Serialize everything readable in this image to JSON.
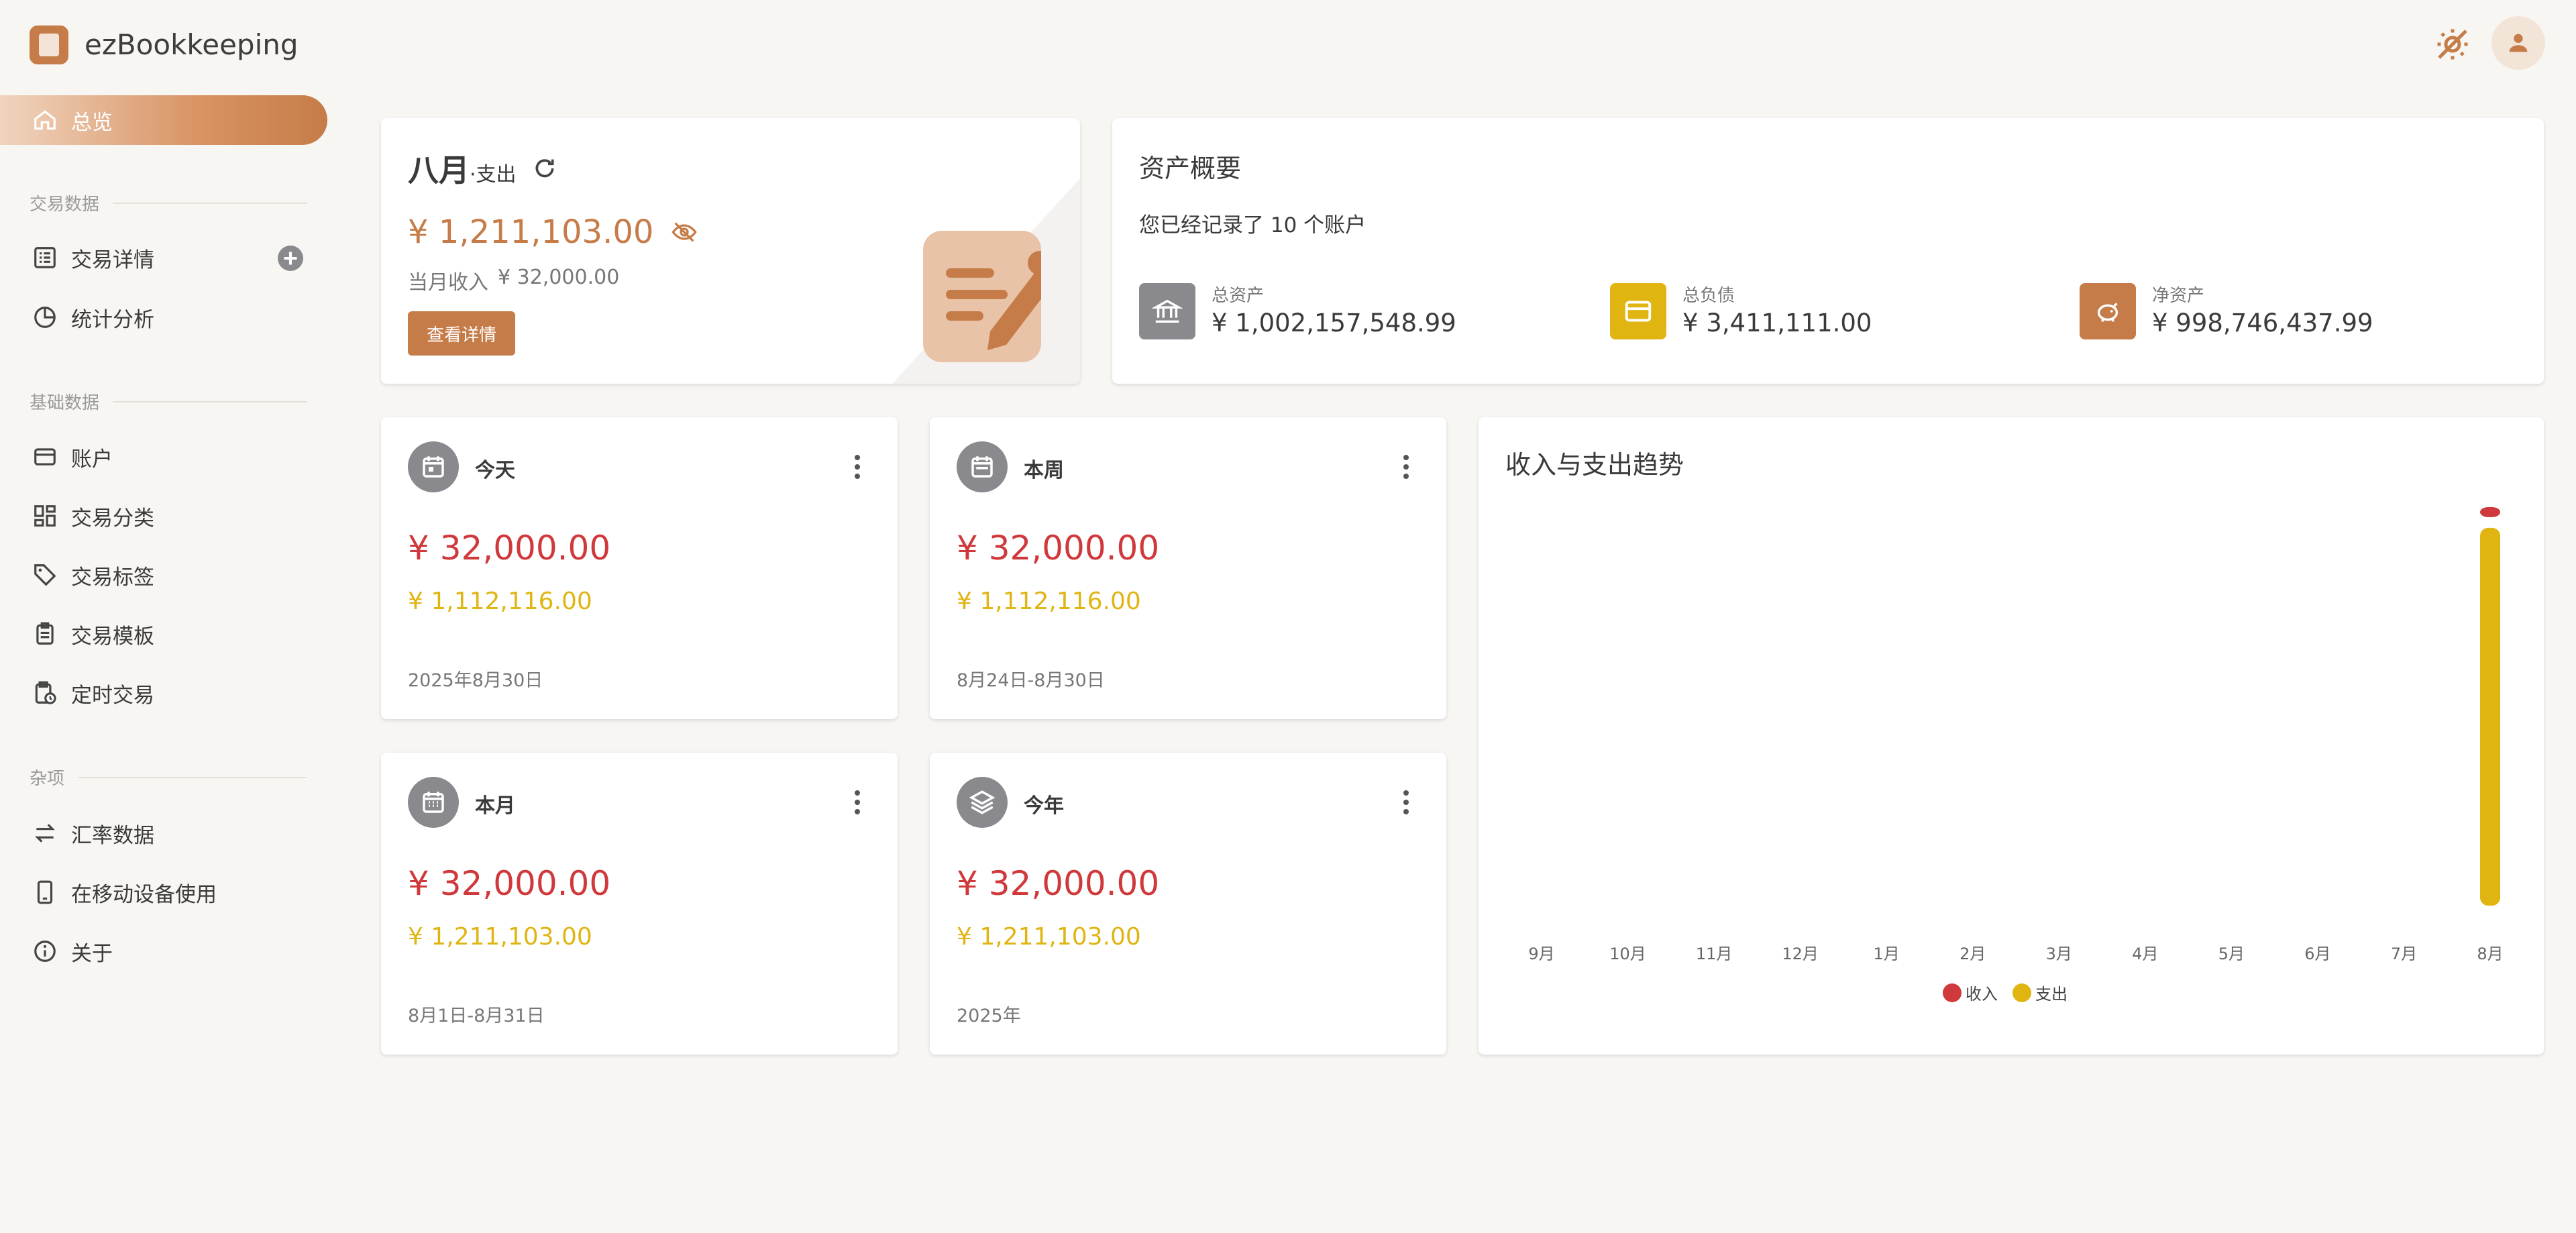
{
  "app": {
    "title": "ezBookkeeping"
  },
  "sidebar": {
    "overview": "总览",
    "sections": {
      "transaction_data": "交易数据",
      "basic_data": "基础数据",
      "misc": "杂项"
    },
    "items": {
      "transaction_details": "交易详情",
      "statistics": "统计分析",
      "accounts": "账户",
      "categories": "交易分类",
      "tags": "交易标签",
      "templates": "交易模板",
      "scheduled": "定时交易",
      "exchange_rates": "汇率数据",
      "mobile": "在移动设备使用",
      "about": "关于"
    }
  },
  "month_card": {
    "month": "八月",
    "suffix": "·支出",
    "amount": "¥ 1,211,103.00",
    "income_label": "当月收入",
    "income_value": "¥ 32,000.00",
    "button": "查看详情"
  },
  "asset_card": {
    "title": "资产概要",
    "subtitle": "您已经记录了 10 个账户",
    "total_assets_label": "总资产",
    "total_assets_value": "¥ 1,002,157,548.99",
    "total_liabilities_label": "总负债",
    "total_liabilities_value": "¥ 3,411,111.00",
    "net_assets_label": "净资产",
    "net_assets_value": "¥ 998,746,437.99",
    "colors": {
      "assets": "#8a8a8e",
      "liabilities": "#e0b512",
      "net": "#c67c48"
    }
  },
  "period_cards": [
    {
      "title": "今天",
      "income": "¥ 32,000.00",
      "expense": "¥ 1,112,116.00",
      "range": "2025年8月30日",
      "icon": "calendar-today-icon"
    },
    {
      "title": "本周",
      "income": "¥ 32,000.00",
      "expense": "¥ 1,112,116.00",
      "range": "8月24日-8月30日",
      "icon": "calendar-week-icon"
    },
    {
      "title": "本月",
      "income": "¥ 32,000.00",
      "expense": "¥ 1,211,103.00",
      "range": "8月1日-8月31日",
      "icon": "calendar-month-icon"
    },
    {
      "title": "今年",
      "income": "¥ 32,000.00",
      "expense": "¥ 1,211,103.00",
      "range": "2025年",
      "icon": "layers-icon"
    }
  ],
  "trend": {
    "title": "收入与支出趋势"
  },
  "chart_data": {
    "type": "bar",
    "title": "收入与支出趋势",
    "categories": [
      "9月",
      "10月",
      "11月",
      "12月",
      "1月",
      "2月",
      "3月",
      "4月",
      "5月",
      "6月",
      "7月",
      "8月"
    ],
    "series": [
      {
        "name": "收入",
        "color": "#d0393b",
        "values": [
          0,
          0,
          0,
          0,
          0,
          0,
          0,
          0,
          0,
          0,
          0,
          32000
        ]
      },
      {
        "name": "支出",
        "color": "#e0b512",
        "values": [
          0,
          0,
          0,
          0,
          0,
          0,
          0,
          0,
          0,
          0,
          0,
          1211103
        ]
      }
    ],
    "stacked": true,
    "grid": false,
    "legend": "bottom-center"
  }
}
